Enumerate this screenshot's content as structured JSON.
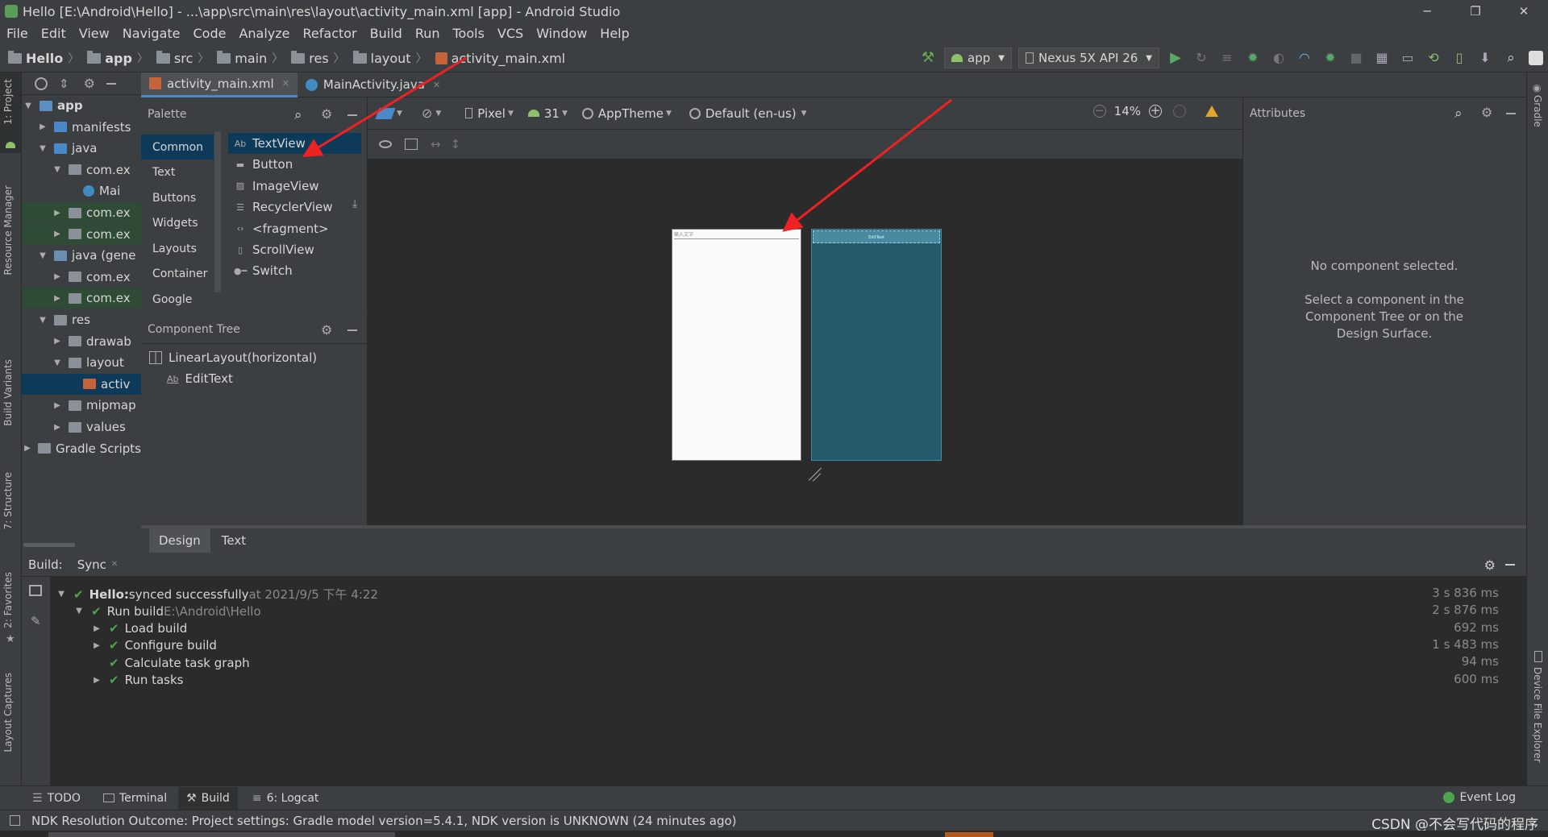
{
  "window": {
    "title": "Hello [E:\\Android\\Hello] - ...\\app\\src\\main\\res\\layout\\activity_main.xml [app] - Android Studio",
    "min": "─",
    "max": "❐",
    "close": "✕"
  },
  "menu": [
    "File",
    "Edit",
    "View",
    "Navigate",
    "Code",
    "Analyze",
    "Refactor",
    "Build",
    "Run",
    "Tools",
    "VCS",
    "Window",
    "Help"
  ],
  "breadcrumb": [
    "Hello",
    "app",
    "src",
    "main",
    "res",
    "layout",
    "activity_main.xml"
  ],
  "toolbar": {
    "config": "app",
    "device": "Nexus 5X API 26"
  },
  "left_strip": {
    "project": "1: Project",
    "resource_manager": "Resource Manager",
    "build_variants": "Build Variants",
    "structure": "7: Structure",
    "favorites": "2: Favorites",
    "layout_captures": "Layout Captures"
  },
  "right_strip": {
    "gradle": "Gradle",
    "device_file_explorer": "Device File Explorer"
  },
  "project_tree": [
    {
      "label": "app",
      "depth": 0,
      "open": true,
      "kind": "folder-app"
    },
    {
      "label": "manifests",
      "depth": 1,
      "open": false,
      "kind": "folder-blue"
    },
    {
      "label": "java",
      "depth": 1,
      "open": true,
      "kind": "folder-blue"
    },
    {
      "label": "com.ex",
      "depth": 2,
      "open": true,
      "kind": "pkg"
    },
    {
      "label": "Mai",
      "depth": 3,
      "open": null,
      "kind": "class"
    },
    {
      "label": "com.ex",
      "depth": 2,
      "open": false,
      "kind": "pkg",
      "hl": true
    },
    {
      "label": "com.ex",
      "depth": 2,
      "open": false,
      "kind": "pkg",
      "hl": true
    },
    {
      "label": "java (gene",
      "depth": 1,
      "open": true,
      "kind": "folder-gen"
    },
    {
      "label": "com.ex",
      "depth": 2,
      "open": false,
      "kind": "pkg"
    },
    {
      "label": "com.ex",
      "depth": 2,
      "open": false,
      "kind": "pkg",
      "hl": true
    },
    {
      "label": "res",
      "depth": 1,
      "open": true,
      "kind": "folder-res"
    },
    {
      "label": "drawab",
      "depth": 2,
      "open": false,
      "kind": "pkg"
    },
    {
      "label": "layout",
      "depth": 2,
      "open": true,
      "kind": "pkg"
    },
    {
      "label": "activ",
      "depth": 3,
      "open": null,
      "kind": "xml",
      "sel": true
    },
    {
      "label": "mipmap",
      "depth": 2,
      "open": false,
      "kind": "pkg"
    },
    {
      "label": "values",
      "depth": 2,
      "open": false,
      "kind": "pkg"
    },
    {
      "label": "Gradle Scripts",
      "depth": 0,
      "open": false,
      "kind": "gradle"
    }
  ],
  "editor_tabs": [
    {
      "label": "activity_main.xml",
      "active": true,
      "close": "✕"
    },
    {
      "label": "MainActivity.java",
      "active": false,
      "close": "✕"
    }
  ],
  "palette": {
    "title": "Palette",
    "categories": [
      "Common",
      "Text",
      "Buttons",
      "Widgets",
      "Layouts",
      "Container",
      "Google"
    ],
    "items": [
      {
        "label": "TextView",
        "icon": "Ab"
      },
      {
        "label": "Button",
        "icon": "btn"
      },
      {
        "label": "ImageView",
        "icon": "img"
      },
      {
        "label": "RecyclerView",
        "icon": "list"
      },
      {
        "label": "<fragment>",
        "icon": "<>"
      },
      {
        "label": "ScrollView",
        "icon": "scroll"
      },
      {
        "label": "Switch",
        "icon": "switch"
      }
    ]
  },
  "component_tree": {
    "title": "Component Tree",
    "nodes": [
      {
        "label": "LinearLayout(horizontal)",
        "depth": 0,
        "icon": "linear-layout"
      },
      {
        "label": "EditText",
        "depth": 1,
        "icon": "Ab",
        "warning": true
      }
    ]
  },
  "design_toolbar": {
    "device": "Pixel",
    "api": "31",
    "theme": "AppTheme",
    "locale": "Default (en-us)",
    "zoom": "14%"
  },
  "design_surface": {
    "edit_hint": "输入文字",
    "blueprint_label": "EditText"
  },
  "attributes": {
    "title": "Attributes",
    "empty_title": "No component selected.",
    "empty_body": "Select a component in the Component Tree or on the Design Surface."
  },
  "view_tabs": [
    "Design",
    "Text"
  ],
  "build": {
    "tab_build": "Build:",
    "tab_sync": "Sync",
    "lines": [
      {
        "depth": 0,
        "arrow": "open",
        "bold": "Hello:",
        "text": " synced successfully",
        "meta": " at 2021/9/5 下午 4:22",
        "time": "3 s 836 ms"
      },
      {
        "depth": 1,
        "arrow": "open",
        "bold": "",
        "text": "Run build",
        "meta": " E:\\Android\\Hello",
        "time": "2 s 876 ms"
      },
      {
        "depth": 2,
        "arrow": "closed",
        "bold": "",
        "text": "Load build",
        "meta": "",
        "time": "692 ms"
      },
      {
        "depth": 2,
        "arrow": "closed",
        "bold": "",
        "text": "Configure build",
        "meta": "",
        "time": "1 s 483 ms"
      },
      {
        "depth": 2,
        "arrow": "none",
        "bold": "",
        "text": "Calculate task graph",
        "meta": "",
        "time": "94 ms"
      },
      {
        "depth": 2,
        "arrow": "closed",
        "bold": "",
        "text": "Run tasks",
        "meta": "",
        "time": "600 ms"
      }
    ]
  },
  "bottom_tabs": [
    "TODO",
    "Terminal",
    "Build",
    "6: Logcat"
  ],
  "event_log": "Event Log",
  "status": "NDK Resolution Outcome: Project settings: Gradle model version=5.4.1, NDK version is UNKNOWN (24 minutes ago)",
  "watermark": "CSDN @不会写代码的程序"
}
